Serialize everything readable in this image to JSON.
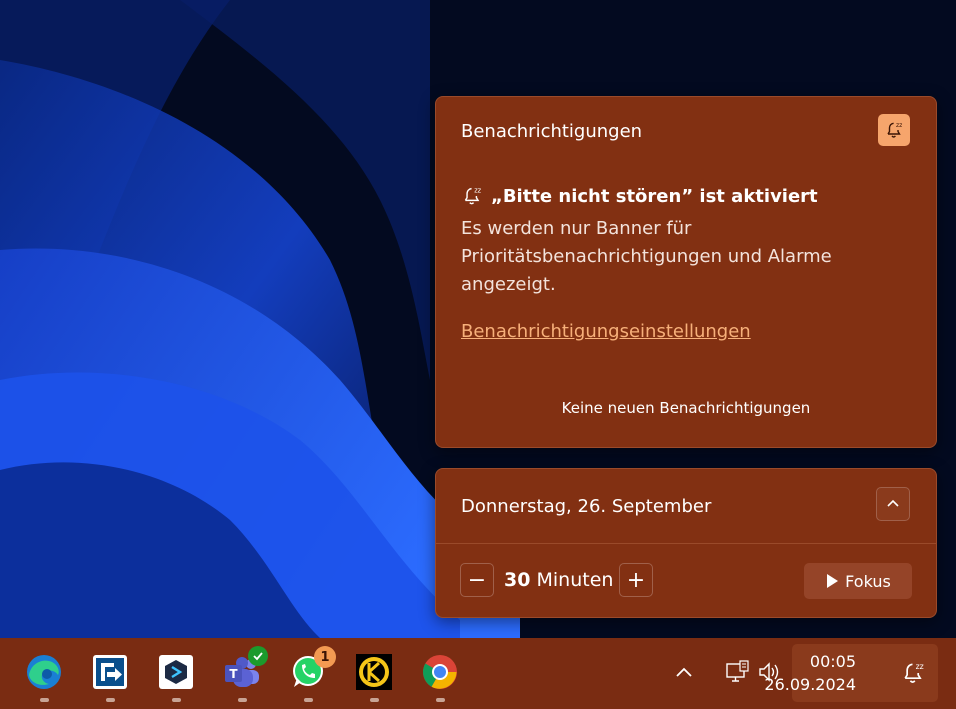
{
  "notifications": {
    "title": "Benachrichtigungen",
    "dnd_heading": "„Bitte nicht stören” ist aktiviert",
    "dnd_description": "Es werden nur Banner für Prioritätsbenachrichtigungen und Alarme angezeigt.",
    "settings_link": "Benachrichtigungseinstellungen",
    "empty_message": "Keine neuen Benachrichtigungen"
  },
  "calendar": {
    "date_label": "Donnerstag, 26. September",
    "focus": {
      "minus_label": "−",
      "duration_value": "30",
      "duration_unit": "Minuten",
      "plus_label": "+",
      "start_label": "Fokus"
    }
  },
  "taskbar": {
    "apps": [
      {
        "name": "edge",
        "icon": "edge-icon"
      },
      {
        "name": "file-transfer",
        "icon": "file-transfer-icon"
      },
      {
        "name": "remote-app",
        "icon": "remote-app-icon"
      },
      {
        "name": "teams",
        "icon": "teams-icon",
        "status": "available"
      },
      {
        "name": "whatsapp",
        "icon": "whatsapp-icon",
        "badge": "1"
      },
      {
        "name": "keeper",
        "icon": "keeper-icon"
      },
      {
        "name": "chrome",
        "icon": "chrome-icon"
      }
    ],
    "tray": {
      "time": "00:05",
      "date": "26.09.2024"
    }
  },
  "colors": {
    "panel_bg": "#823012",
    "taskbar_bg": "#7a2c12",
    "accent": "#f6a56c",
    "link": "#f7b07a"
  }
}
